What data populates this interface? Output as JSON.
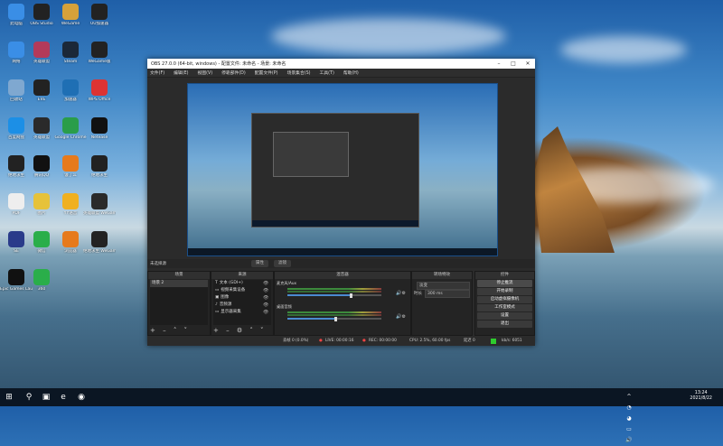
{
  "desktop": {
    "icons": [
      {
        "label": "此电脑",
        "color": "#3a8ee6"
      },
      {
        "label": "OBS Studio",
        "color": "#222"
      },
      {
        "label": "WeGame",
        "color": "#d6a13a"
      },
      {
        "label": "UU加速器",
        "color": "#222"
      },
      {
        "label": "网络",
        "color": "#3a8ee6"
      },
      {
        "label": "英雄联盟",
        "color": "#b33a5a"
      },
      {
        "label": "Steam",
        "color": "#1b2838"
      },
      {
        "label": "WeGame版",
        "color": "#222"
      },
      {
        "label": "回收站",
        "color": "#7fa8d0"
      },
      {
        "label": "EVE",
        "color": "#222"
      },
      {
        "label": "加速器",
        "color": "#1f6fb4"
      },
      {
        "label": "WPS Office",
        "color": "#d33"
      },
      {
        "label": "百度网盘",
        "color": "#1c8fe6"
      },
      {
        "label": "英雄联盟",
        "color": "#2a2a2a"
      },
      {
        "label": "Google Chrome",
        "color": "#2a9d4a"
      },
      {
        "label": "Netease",
        "color": "#111"
      },
      {
        "label": "绝地求生",
        "color": "#222"
      },
      {
        "label": "腾讯QQ",
        "color": "#111"
      },
      {
        "label": "饿了么",
        "color": "#e67a1c"
      },
      {
        "label": "绝地求生",
        "color": "#222"
      },
      {
        "label": "PDF",
        "color": "#eee"
      },
      {
        "label": "图片",
        "color": "#e6c23a"
      },
      {
        "label": "YY语音",
        "color": "#f0b020"
      },
      {
        "label": "英雄联盟 WeGame版",
        "color": "#2a2a2a"
      },
      {
        "label": "SE",
        "color": "#2a3b8a"
      },
      {
        "label": "微信",
        "color": "#2aae4a"
      },
      {
        "label": "浏览器",
        "color": "#e67a1c"
      },
      {
        "label": "绝地求生 WeGame版",
        "color": "#222"
      },
      {
        "label": "Epic Games Launcher",
        "color": "#111"
      },
      {
        "label": "360",
        "color": "#2aae4a"
      }
    ]
  },
  "obs": {
    "title": "OBS 27.0.0 (64-bit, windows) - 配置文件: 未命名 - 场景: 未命名",
    "menu": [
      "文件(F)",
      "编辑(E)",
      "视图(V)",
      "停靠部件(D)",
      "配置文件(P)",
      "场景集合(S)",
      "工具(T)",
      "帮助(H)"
    ],
    "source_bar": {
      "label": "未选择源",
      "props": "属性",
      "filters": "滤镜"
    },
    "docks": {
      "scenes": {
        "title": "场景",
        "items": [
          "场景 2"
        ]
      },
      "sources": {
        "title": "来源",
        "items": [
          "文本 (GDI+)",
          "视频采集设备",
          "图像",
          "音频源",
          "显示器采集"
        ]
      },
      "mixer": {
        "title": "混音器",
        "tracks": [
          {
            "name": "麦克风/Aux",
            "level": 0.66
          },
          {
            "name": "桌面音频",
            "level": 0.5
          }
        ]
      },
      "transitions": {
        "title": "转场特效",
        "type": "淡变",
        "duration_label": "时长",
        "duration": "300 ms"
      },
      "controls": {
        "title": "控件",
        "buttons": [
          "停止推流",
          "开始录制",
          "启动虚拟摄像机",
          "工作室模式",
          "设置",
          "退出"
        ]
      }
    },
    "status": {
      "dropped": "丢帧 0 (0.0%)",
      "live": "LIVE: 00:00:16",
      "rec": "REC: 00:00:00",
      "cpu": "CPU: 2.5%, 60.00 fps",
      "kbps": "kb/s: 6051",
      "delay": "延迟 0"
    }
  },
  "taskbar": {
    "time": "13:24",
    "date": "2021/8/22"
  }
}
